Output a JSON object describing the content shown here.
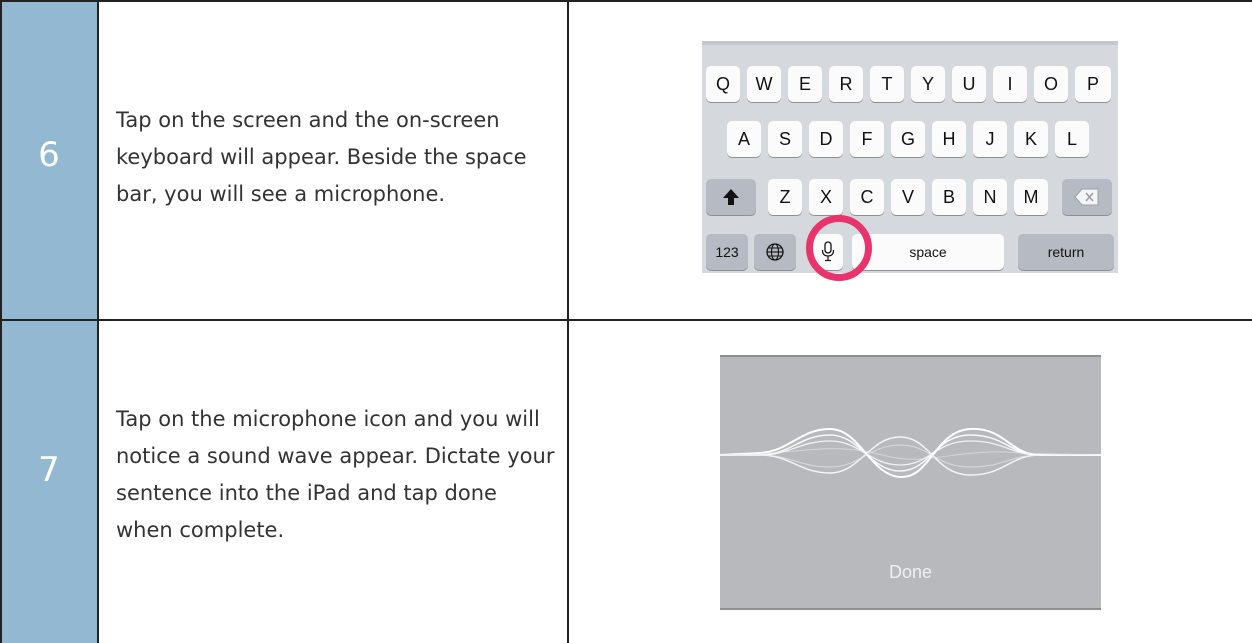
{
  "rows": [
    {
      "number": "6",
      "text": "Tap on the screen and the on-screen keyboard will appear. Beside the space bar, you will see a microphone."
    },
    {
      "number": "7",
      "text": "Tap on the microphone icon and you will notice a sound wave appear. Dictate your sentence into the iPad and tap done when complete."
    }
  ],
  "keyboard": {
    "row1": [
      "Q",
      "W",
      "E",
      "R",
      "T",
      "Y",
      "U",
      "I",
      "O",
      "P"
    ],
    "row2": [
      "A",
      "S",
      "D",
      "F",
      "G",
      "H",
      "J",
      "K",
      "L"
    ],
    "row3": [
      "Z",
      "X",
      "C",
      "V",
      "B",
      "N",
      "M"
    ],
    "numbers_key": "123",
    "space_key": "space",
    "return_key": "return",
    "highlight_color": "#e9336c",
    "icons": [
      "shift-icon",
      "backspace-icon",
      "globe-icon",
      "microphone-icon"
    ]
  },
  "dictation": {
    "done_label": "Done",
    "icons": [
      "sound-wave-icon"
    ]
  },
  "colors": {
    "number_cell_bg": "#93b9d2",
    "keyboard_bg": "#d5d8dd",
    "dictation_bg": "#b7b9bc"
  }
}
